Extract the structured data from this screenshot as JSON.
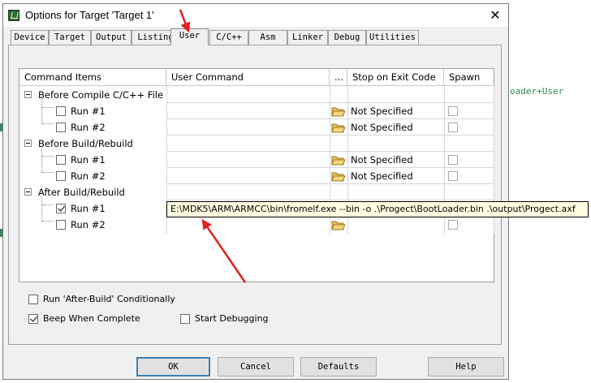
{
  "background": {
    "code_text": "oader+User"
  },
  "window": {
    "title": "Options for Target 'Target 1'",
    "close_glyph": "✕"
  },
  "tabs": [
    {
      "label": "Device"
    },
    {
      "label": "Target"
    },
    {
      "label": "Output"
    },
    {
      "label": "Listing"
    },
    {
      "label": "User",
      "active": true
    },
    {
      "label": "C/C++"
    },
    {
      "label": "Asm"
    },
    {
      "label": "Linker"
    },
    {
      "label": "Debug"
    },
    {
      "label": "Utilities"
    }
  ],
  "grid": {
    "headers": {
      "command_items": "Command Items",
      "user_command": "User Command",
      "browse": "...",
      "stop_on_exit": "Stop on Exit Code",
      "spawn": "Spawn"
    },
    "groups": {
      "before_compile": {
        "label": "Before Compile C/C++ File",
        "run1": {
          "label": "Run #1",
          "checked": false,
          "stop": "Not Specified"
        },
        "run2": {
          "label": "Run #2",
          "checked": false,
          "stop": "Not Specified"
        }
      },
      "before_build": {
        "label": "Before Build/Rebuild",
        "run1": {
          "label": "Run #1",
          "checked": false,
          "stop": "Not Specified"
        },
        "run2": {
          "label": "Run #2",
          "checked": false,
          "stop": "Not Specified"
        }
      },
      "after_build": {
        "label": "After Build/Rebuild",
        "run1": {
          "label": "Run #1",
          "checked": true,
          "stop": ""
        },
        "run2": {
          "label": "Run #2",
          "checked": false,
          "stop": ""
        }
      }
    }
  },
  "tooltip": {
    "text": "E:\\MDK5\\ARM\\ARMCC\\bin\\fromelf.exe  --bin -o  .\\Progect\\BootLoader.bin  .\\output\\Progect.axf"
  },
  "options": {
    "run_after_build": {
      "label": "Run 'After-Build' Conditionally",
      "checked": false
    },
    "beep": {
      "label": "Beep When Complete",
      "checked": true
    },
    "start_debugging": {
      "label": "Start Debugging",
      "checked": false
    }
  },
  "buttons": {
    "ok": "OK",
    "cancel": "Cancel",
    "defaults": "Defaults",
    "help": "Help"
  },
  "colors": {
    "annotation_arrow": "#e0201c",
    "tooltip_bg": "#ffffe1",
    "code_green": "#2e8b57"
  },
  "icons": {
    "browse": "folder-open-icon",
    "app": "keil-uvision-icon",
    "close": "close-icon"
  }
}
